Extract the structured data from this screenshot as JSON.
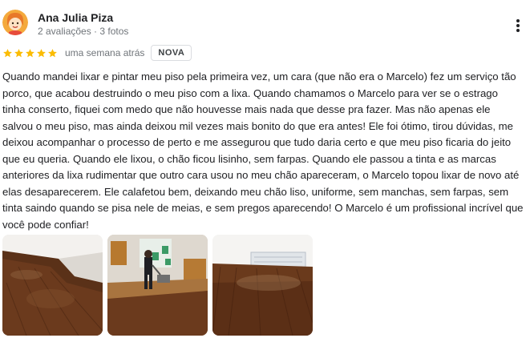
{
  "reviewer": {
    "name": "Ana Julia Piza",
    "meta": "2 avaliações · 3 fotos",
    "avatar_icon": "cartoon-avatar-icon"
  },
  "rating": {
    "stars": 5,
    "star_color": "#fbbc04",
    "time_ago": "uma semana atrás",
    "badge": "NOVA"
  },
  "review": {
    "text": "Quando mandei lixar e pintar meu piso pela primeira vez, um cara (que não era o Marcelo) fez um serviço tão porco, que acabou destruindo o meu piso com a lixa. Quando chamamos o Marcelo para ver se o estrago tinha conserto, fiquei com medo que não houvesse mais nada que desse pra fazer. Mas não apenas ele salvou o meu piso, mas ainda deixou mil vezes mais bonito do que era antes! Ele foi ótimo, tirou dúvidas, me deixou acompanhar o processo de perto e me assegurou que tudo daria certo e que meu piso ficaria do jeito que eu queria. Quando ele lixou, o chão ficou lisinho, sem farpas. Quando ele passou a tinta e as marcas anteriores da lixa rudimentar que outro cara usou no meu chão apareceram, o Marcelo topou lixar de novo até elas desaparecerem. Ele calafetou bem, deixando meu chão liso, uniforme, sem manchas, sem farpas, sem tinta saindo quando se pisa nele de meias, e sem pregos aparecendo! O Marcelo é um profissional incrível que você pode confiar!"
  },
  "photos": [
    {
      "name": "photo-wood-floor-corner"
    },
    {
      "name": "photo-floor-sanding-worker"
    },
    {
      "name": "photo-finished-floor-room"
    }
  ],
  "icons": {
    "more": "more-vertical-icon",
    "star": "star-icon"
  }
}
